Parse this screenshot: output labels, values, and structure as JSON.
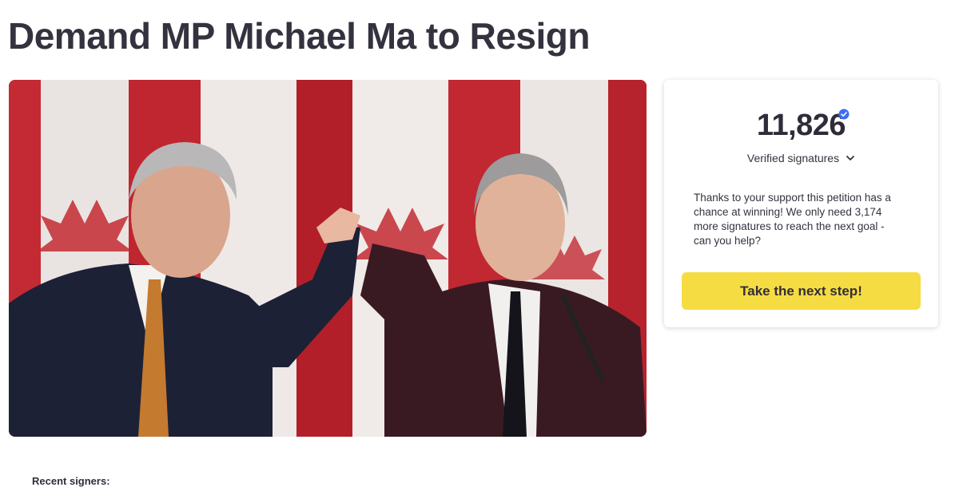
{
  "petition": {
    "title": "Demand MP Michael Ma to Resign"
  },
  "signatures": {
    "count": "11,826",
    "label": "Verified signatures",
    "message": "Thanks to your support this petition has a chance at winning! We only need 3,174 more signatures to reach the next goal - can you help?",
    "cta_label": "Take the next step!"
  },
  "recent": {
    "heading": "Recent signers:"
  },
  "colors": {
    "cta": "#f6dc43",
    "verified_badge": "#3d6ef5",
    "title_text": "#35323f"
  },
  "icons": {
    "verified": "verified-badge-icon",
    "expand": "chevron-down-icon"
  }
}
